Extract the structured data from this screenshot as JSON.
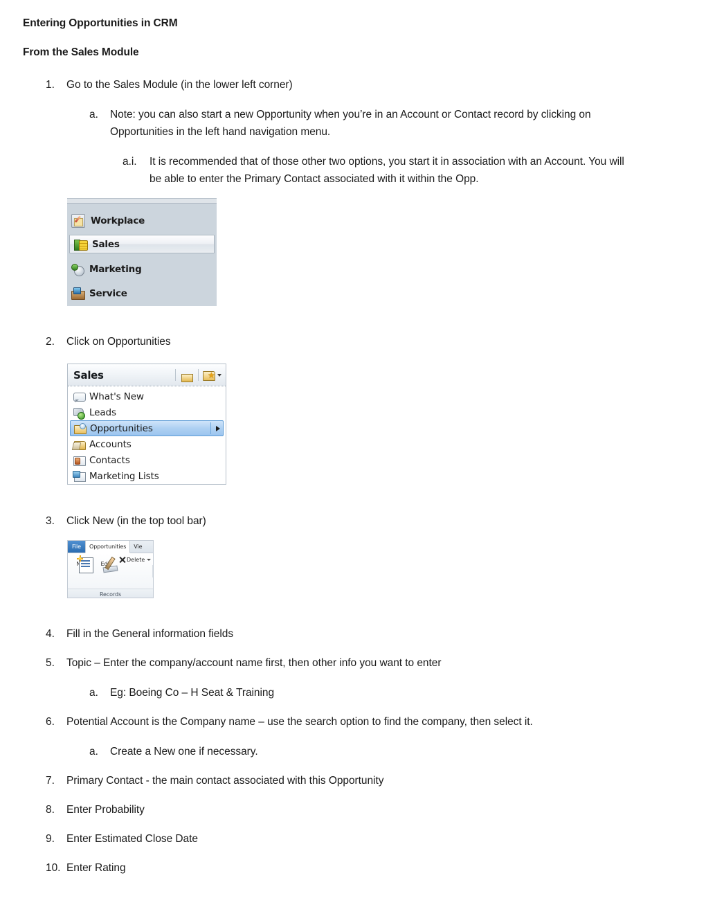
{
  "document": {
    "heading_title": "Entering Opportunities in CRM",
    "heading_subtitle": "From the Sales Module",
    "items": [
      {
        "marker": "1.",
        "text": "Go to the Sales Module (in the lower left corner)"
      },
      {
        "marker": "a.",
        "text": "Note: you can also start a new Opportunity when you’re in an Account or Contact record by clicking on Opportunities in the left hand navigation menu."
      },
      {
        "marker": "a.i.",
        "text": "It is recommended that of those other two options, you start it in association with an Account.  You will be able to enter the Primary Contact associated with it within the Opp."
      },
      {
        "marker": "2.",
        "text": "Click on Opportunities"
      },
      {
        "marker": "3.",
        "text": "Click New (in the top tool bar)"
      },
      {
        "marker": "4.",
        "text": "Fill in the General information fields"
      },
      {
        "marker": "5.",
        "text": "Topic – Enter the company/account name first, then other info you want to enter"
      },
      {
        "marker": "a.",
        "text": "Eg: Boeing Co – H Seat & Training"
      },
      {
        "marker": "6.",
        "text": "Potential Account is the Company name – use the search option to find the company, then select it."
      },
      {
        "marker": "a.",
        "text": "Create a New one if necessary."
      },
      {
        "marker": "7.",
        "text": "Primary Contact -  the main contact associated with this Opportunity"
      },
      {
        "marker": "8.",
        "text": "Enter Probability"
      },
      {
        "marker": "9.",
        "text": "Enter Estimated Close Date"
      },
      {
        "marker": "10.",
        "text": "Enter Rating"
      }
    ]
  },
  "screenshot_module_nav": {
    "items": [
      {
        "label": "Workplace",
        "icon": "workplace-icon",
        "selected": false
      },
      {
        "label": "Sales",
        "icon": "sales-icon",
        "selected": true
      },
      {
        "label": "Marketing",
        "icon": "marketing-icon",
        "selected": false
      },
      {
        "label": "Service",
        "icon": "service-icon",
        "selected": false
      }
    ],
    "background_color": "#ccd5dd"
  },
  "screenshot_sales_menu": {
    "title": "Sales",
    "header_icons": [
      {
        "name": "home-icon"
      },
      {
        "name": "favorites-folder-icon"
      }
    ],
    "items": [
      {
        "label": "What's New",
        "icon": "whats-new-icon",
        "selected": false,
        "has_submenu": false
      },
      {
        "label": "Leads",
        "icon": "leads-icon",
        "selected": false,
        "has_submenu": false
      },
      {
        "label": "Opportunities",
        "icon": "opportunities-folder-icon",
        "selected": true,
        "has_submenu": true
      },
      {
        "label": "Accounts",
        "icon": "accounts-folder-icon",
        "selected": false,
        "has_submenu": false
      },
      {
        "label": "Contacts",
        "icon": "contacts-card-icon",
        "selected": false,
        "has_submenu": false
      },
      {
        "label": "Marketing Lists",
        "icon": "marketing-lists-icon",
        "selected": false,
        "has_submenu": false
      }
    ],
    "selected_highlight_color": "#aed0f2"
  },
  "screenshot_ribbon": {
    "tabs": [
      {
        "label": "File",
        "style": "file",
        "active": false
      },
      {
        "label": "Opportunities",
        "style": "normal",
        "active": true
      },
      {
        "label": "Vie",
        "style": "normal",
        "active": false
      }
    ],
    "buttons": [
      {
        "label": "New",
        "icon": "new-record-icon",
        "size": "large"
      },
      {
        "label": "Edit",
        "icon": "edit-record-icon",
        "size": "large"
      },
      {
        "label": "Delete",
        "icon": "delete-x-icon",
        "size": "small",
        "has_caret": true
      }
    ],
    "group_name": "Records",
    "file_tab_color": "#2b6cb0"
  }
}
